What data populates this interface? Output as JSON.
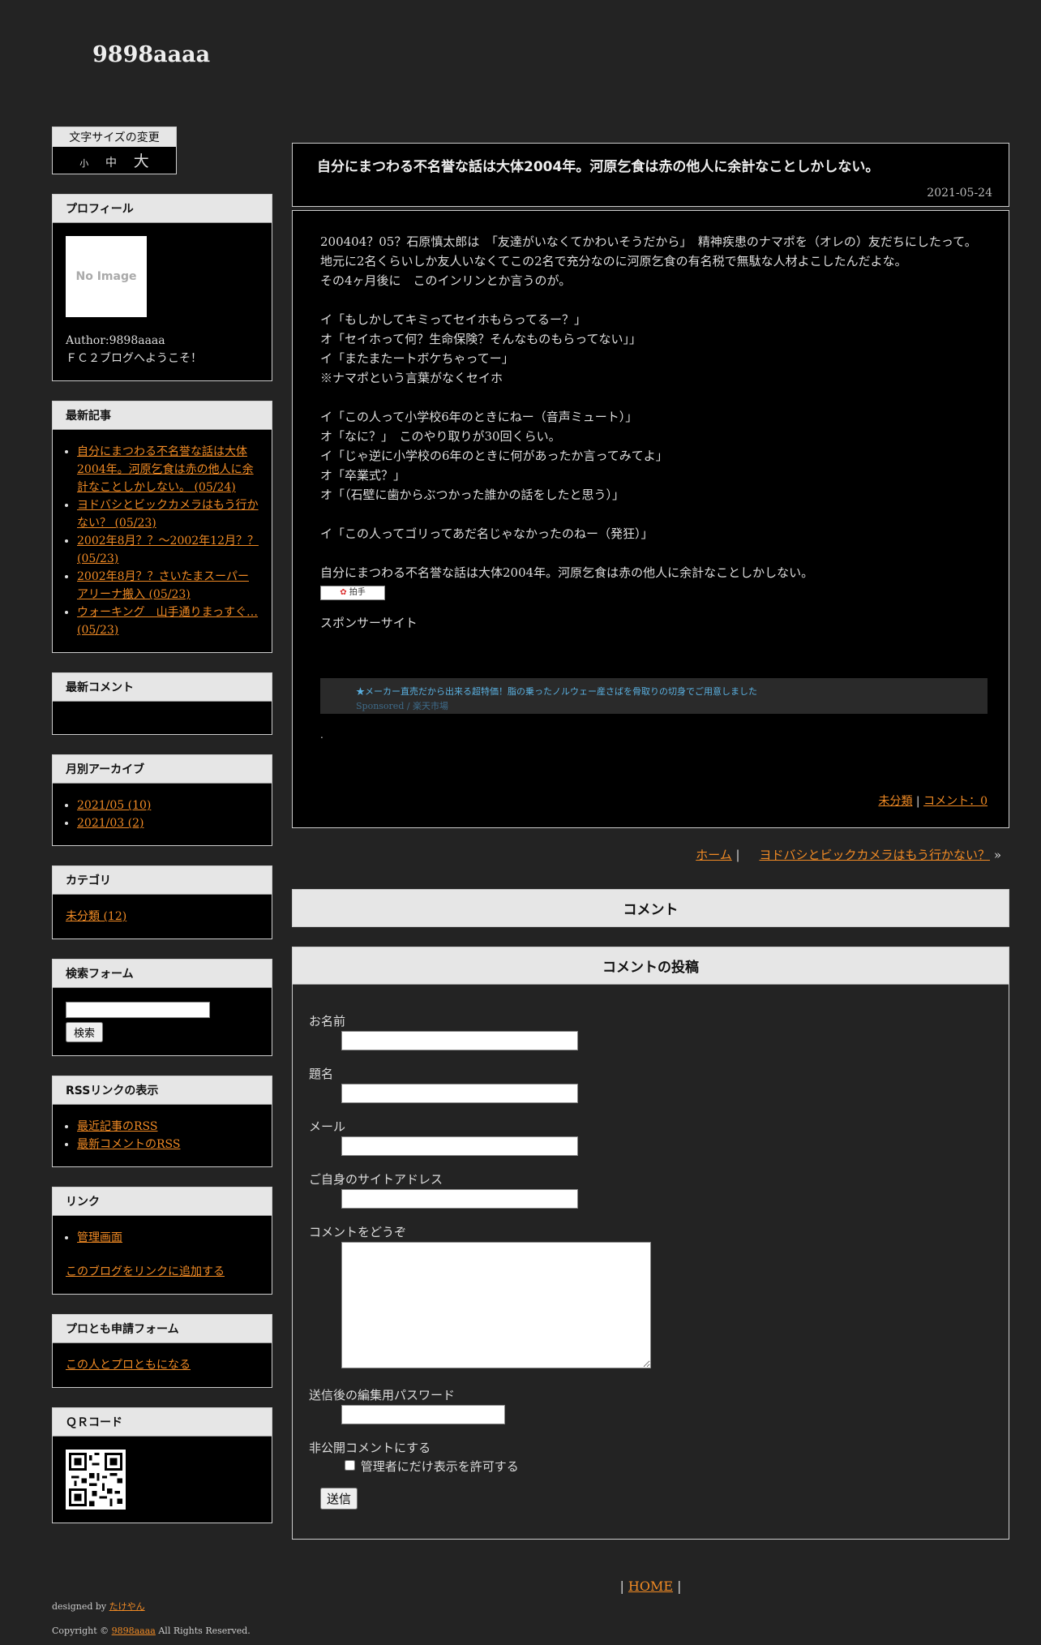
{
  "blog_title": "9898aaaa",
  "font_size_box": {
    "label": "文字サイズの変更",
    "small": "小",
    "medium": "中",
    "large": "大"
  },
  "profile": {
    "heading": "プロフィール",
    "noimage": "No Image",
    "author": "Author:9898aaaa",
    "welcome": "ＦＣ２ブログへようこそ！"
  },
  "recent_entries": {
    "heading": "最新記事",
    "items": [
      "自分にまつわる不名誉な話は大体2004年。河原乞食は赤の他人に余計なことしかしない。 (05/24)",
      "ヨドバシとビックカメラはもう行かない？ (05/23)",
      "2002年8月？？～2002年12月？？ (05/23)",
      "2002年8月？？さいたまスーパーアリーナ搬入 (05/23)",
      "ウォーキング　山手通りまっすぐ… (05/23)"
    ]
  },
  "recent_comments": {
    "heading": "最新コメント"
  },
  "monthly_archive": {
    "heading": "月別アーカイブ",
    "items": [
      "2021/05 (10)",
      "2021/03 (2)"
    ]
  },
  "categories": {
    "heading": "カテゴリ",
    "items": [
      "未分類 (12)"
    ]
  },
  "search": {
    "heading": "検索フォーム",
    "button": "検索"
  },
  "rss": {
    "heading": "RSSリンクの表示",
    "items": [
      "最近記事のRSS",
      "最新コメントのRSS"
    ]
  },
  "links": {
    "heading": "リンク",
    "items": [
      "管理画面"
    ],
    "add_link": "このブログをリンクに追加する"
  },
  "profriend": {
    "heading": "プロとも申請フォーム",
    "link": "この人とプロともになる"
  },
  "qr": {
    "heading": "ＱＲコード"
  },
  "footer_left": {
    "designed_prefix": "designed by",
    "designer": "たけやん",
    "copyright_prefix": "Copyright ©",
    "copyright_name": "9898aaaa",
    "copyright_suffix": "All Rights Reserved."
  },
  "entry": {
    "title": "自分にまつわる不名誉な話は大体2004年。河原乞食は赤の他人に余計なことしかしない。",
    "date": "2021-05-24",
    "lines": [
      "200404？05？石原慎太郎は　「友達がいなくてかわいそうだから」　精神疾患のナマポを（オレの）友だちにしたって。",
      "地元に2名くらいしか友人いなくてこの2名で充分なのに河原乞食の有名税で無駄な人材よこしたんだよな。",
      "その4ヶ月後に　このインリンとか言うのが。",
      "",
      "イ「もしかしてキミってセイホもらってるー？」",
      "オ「セイホって何？生命保険？そんなものもらってない」」",
      "イ「またまたートボケちゃってー」",
      "※ナマポという言葉がなくセイホ",
      "",
      "イ「この人って小学校6年のときにねー（音声ミュート）」",
      "オ「なに？」　このやり取りが30回くらい。",
      "イ「じゃ逆に小学校の6年のときに何があったか言ってみてよ」",
      "オ「卒業式？」",
      "オ「（石壁に歯からぶつかった誰かの話をしたと思う）」",
      "",
      "イ「この人ってゴリってあだ名じゃなかったのねー（発狂）」",
      "",
      "自分にまつわる不名誉な話は大体2004年。河原乞食は赤の他人に余計なことしかしない。"
    ],
    "clap": "拍手",
    "sponsor": "スポンサーサイト",
    "ad_text": "★メーカー直売だから出来る超特価！脂の乗ったノルウェー産さばを骨取りの切身でご用意しました",
    "ad_sponsor": "Sponsored / 楽天市場",
    "dot": ".",
    "category": "未分類",
    "comment_count": "コメント：0"
  },
  "nav": {
    "home": "ホーム",
    "next": "ヨドバシとビックカメラはもう行かない？",
    "arrow": "»"
  },
  "comments_heading": "コメント",
  "post_form": {
    "heading": "コメントの投稿",
    "name_label": "お名前",
    "subject_label": "題名",
    "mail_label": "メール",
    "url_label": "ご自身のサイトアドレス",
    "comment_label": "コメントをどうぞ",
    "pass_label": "送信後の編集用パスワード",
    "secret_label": "非公開コメントにする",
    "secret_check": "管理者にだけ表示を許可する",
    "submit": "送信"
  },
  "footer_home": "HOME"
}
